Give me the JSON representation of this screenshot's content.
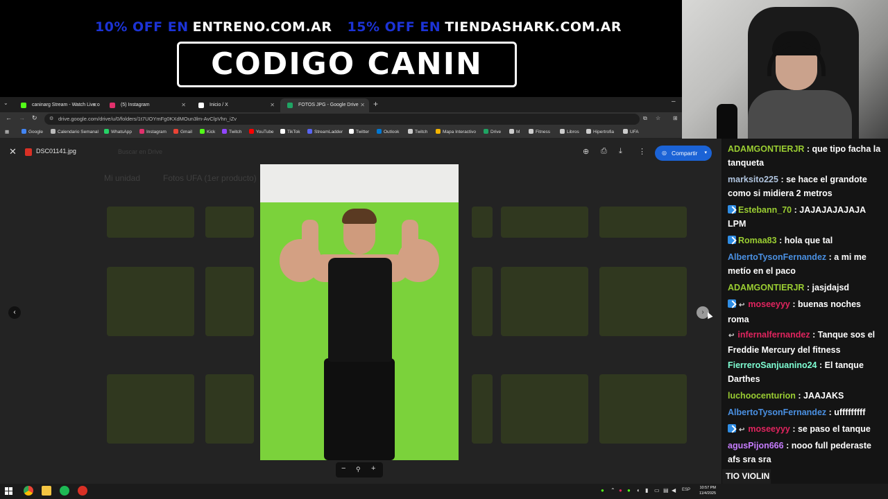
{
  "stream_overlay": {
    "promo_1_percent": "10% OFF EN",
    "promo_1_site": "ENTRENO.COM.AR",
    "promo_2_percent": "15% OFF EN",
    "promo_2_site": "TIENDASHARK.COM.AR",
    "code_text": "CODIGO CANIN"
  },
  "browser": {
    "tabs": [
      {
        "label": "caninarg Stream - Watch Live o",
        "color": "#53fc18"
      },
      {
        "label": "(5) Instagram",
        "color": "#e1306c"
      },
      {
        "label": "Inicio / X",
        "color": "#ffffff"
      },
      {
        "label": "FOTOS JPG - Google Drive",
        "color": "#1fa463",
        "active": true
      }
    ],
    "url": "drive.google.com/drive/u/0/folders/1t7UOYmFg0KXdMOun3lm-AvClpVhn_iZv",
    "bookmarks": [
      {
        "label": "Google",
        "color": "#4285f4"
      },
      {
        "label": "Calendario Semanal",
        "color": "#bbbbbb"
      },
      {
        "label": "WhatsApp",
        "color": "#25d366"
      },
      {
        "label": "Instagram",
        "color": "#e1306c"
      },
      {
        "label": "Gmail",
        "color": "#ea4335"
      },
      {
        "label": "Kick",
        "color": "#53fc18"
      },
      {
        "label": "Twitch",
        "color": "#9146ff"
      },
      {
        "label": "YouTube",
        "color": "#ff0000"
      },
      {
        "label": "TikTok",
        "color": "#ffffff"
      },
      {
        "label": "StreamLadder",
        "color": "#5865f2"
      },
      {
        "label": "Twitter",
        "color": "#ffffff"
      },
      {
        "label": "Outlook",
        "color": "#0078d4"
      },
      {
        "label": "Twitch",
        "color": "#cccccc"
      },
      {
        "label": "Mapa Interactivo",
        "color": "#f4b400"
      },
      {
        "label": "Drive",
        "color": "#1fa463"
      },
      {
        "label": "M",
        "color": "#cccccc"
      },
      {
        "label": "Fitness",
        "color": "#cccccc"
      },
      {
        "label": "Libros",
        "color": "#cccccc"
      },
      {
        "label": "Hipertrofia",
        "color": "#cccccc"
      },
      {
        "label": "UFA",
        "color": "#cccccc"
      }
    ]
  },
  "viewer": {
    "file_name": "DSC01141.jpg",
    "share_label": "Compartir",
    "bg_breadcrumb_1": "Mi unidad",
    "bg_breadcrumb_2": "Fotos UFA (1er producto)",
    "bg_search": "Buscar en Drive"
  },
  "chat": {
    "messages": [
      {
        "user": "ADAMGONTIERJR",
        "color": "#9acd32",
        "text": ": que tipo facha la tanqueta",
        "badge": false,
        "reply": false
      },
      {
        "user": "marksito225",
        "color": "#b0c4de",
        "text": ": se hace el grandote como si midiera 2 metros",
        "badge": false,
        "reply": false
      },
      {
        "user": "Estebann_70",
        "color": "#9acd32",
        "text": ": JAJAJAJAJAJA LPM",
        "badge": true,
        "reply": false
      },
      {
        "user": "Romaa83",
        "color": "#9acd32",
        "text": ": hola que tal",
        "badge": true,
        "reply": false
      },
      {
        "user": "AlbertoTysonFernandez",
        "color": "#4a90e2",
        "text": ": a mi me metío en el paco",
        "badge": false,
        "reply": false
      },
      {
        "user": "ADAMGONTIERJR",
        "color": "#9acd32",
        "text": ": jasjdajsd",
        "badge": false,
        "reply": false
      },
      {
        "user": "moseeyyy",
        "color": "#e0245e",
        "text": ": buenas noches roma",
        "badge": true,
        "reply": true
      },
      {
        "user": "infernalfernandez",
        "color": "#e0245e",
        "text": ": Tanque sos el Freddie Mercury del fitness",
        "badge": false,
        "reply": true
      },
      {
        "user": "FierreroSanjuanino24",
        "color": "#7fffd4",
        "text": ": El tanque Darthes",
        "badge": false,
        "reply": false
      },
      {
        "user": "luchoocenturion",
        "color": "#9acd32",
        "text": ": JAAJAKS",
        "badge": false,
        "reply": false
      },
      {
        "user": "AlbertoTysonFernandez",
        "color": "#4a90e2",
        "text": ": ufffffffff",
        "badge": false,
        "reply": false
      },
      {
        "user": "moseeyyy",
        "color": "#e0245e",
        "text": ": se paso el tanque",
        "badge": true,
        "reply": true
      },
      {
        "user": "agusPijon666",
        "color": "#c77dff",
        "text": ": nooo full pederaste afs sra sra",
        "badge": false,
        "reply": false
      }
    ],
    "input_text": "TIO VIOLIN"
  },
  "taskbar": {
    "language": "ESP",
    "time": "10:57 PM",
    "date": "11/4/2025"
  }
}
